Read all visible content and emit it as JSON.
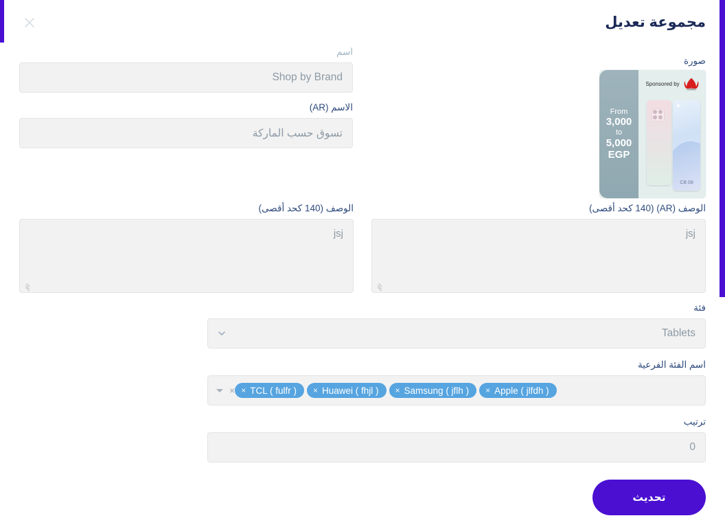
{
  "header": {
    "title": "مجموعة تعديل",
    "close_icon": "close-icon"
  },
  "image_field": {
    "label": "صورة",
    "banner": {
      "from_text": "From",
      "from_amount": "3,000",
      "to_text": "to",
      "to_amount": "5,000",
      "currency": "EGP",
      "sponsor_text": "Sponsored by",
      "brand": "HUAWEI",
      "phone_label": "CB 08"
    }
  },
  "fields": {
    "name": {
      "label": "اسم",
      "value": "Shop by Brand",
      "placeholder": "Shop by Brand"
    },
    "name_ar": {
      "label": "الاسم (AR)",
      "value": "تسوق حسب الماركة",
      "placeholder": "تسوق حسب الماركة"
    },
    "description": {
      "label": "الوصف (140 كحد أقصى)",
      "value": "jsj",
      "placeholder": "jsj"
    },
    "description_ar": {
      "label": "الوصف (AR) (140 كحد أقصى)",
      "value": "jsj",
      "placeholder": "jsj"
    },
    "category": {
      "label": "فئة",
      "value": "Tablets"
    },
    "subcategory": {
      "label": "اسم الفئة الفرعية",
      "tags": [
        {
          "label": "Apple ( jlfdh )",
          "remove": "×"
        },
        {
          "label": "Samsung ( jflh )",
          "remove": "×"
        },
        {
          "label": "Huawei ( fhjl )",
          "remove": "×"
        },
        {
          "label": "TCL ( fulfr )",
          "remove": "×"
        }
      ],
      "clear_label": "×"
    },
    "order": {
      "label": "ترتيب",
      "value": "0"
    }
  },
  "footer": {
    "submit_label": "تحديث"
  },
  "colors": {
    "accent_purple": "#4a0fd1",
    "title_navy": "#1b2a57",
    "label_navy": "#2e4a7d",
    "label_muted": "#9fb6c4",
    "tag_blue": "#56a4e0",
    "field_bg": "#f2f2f2"
  }
}
